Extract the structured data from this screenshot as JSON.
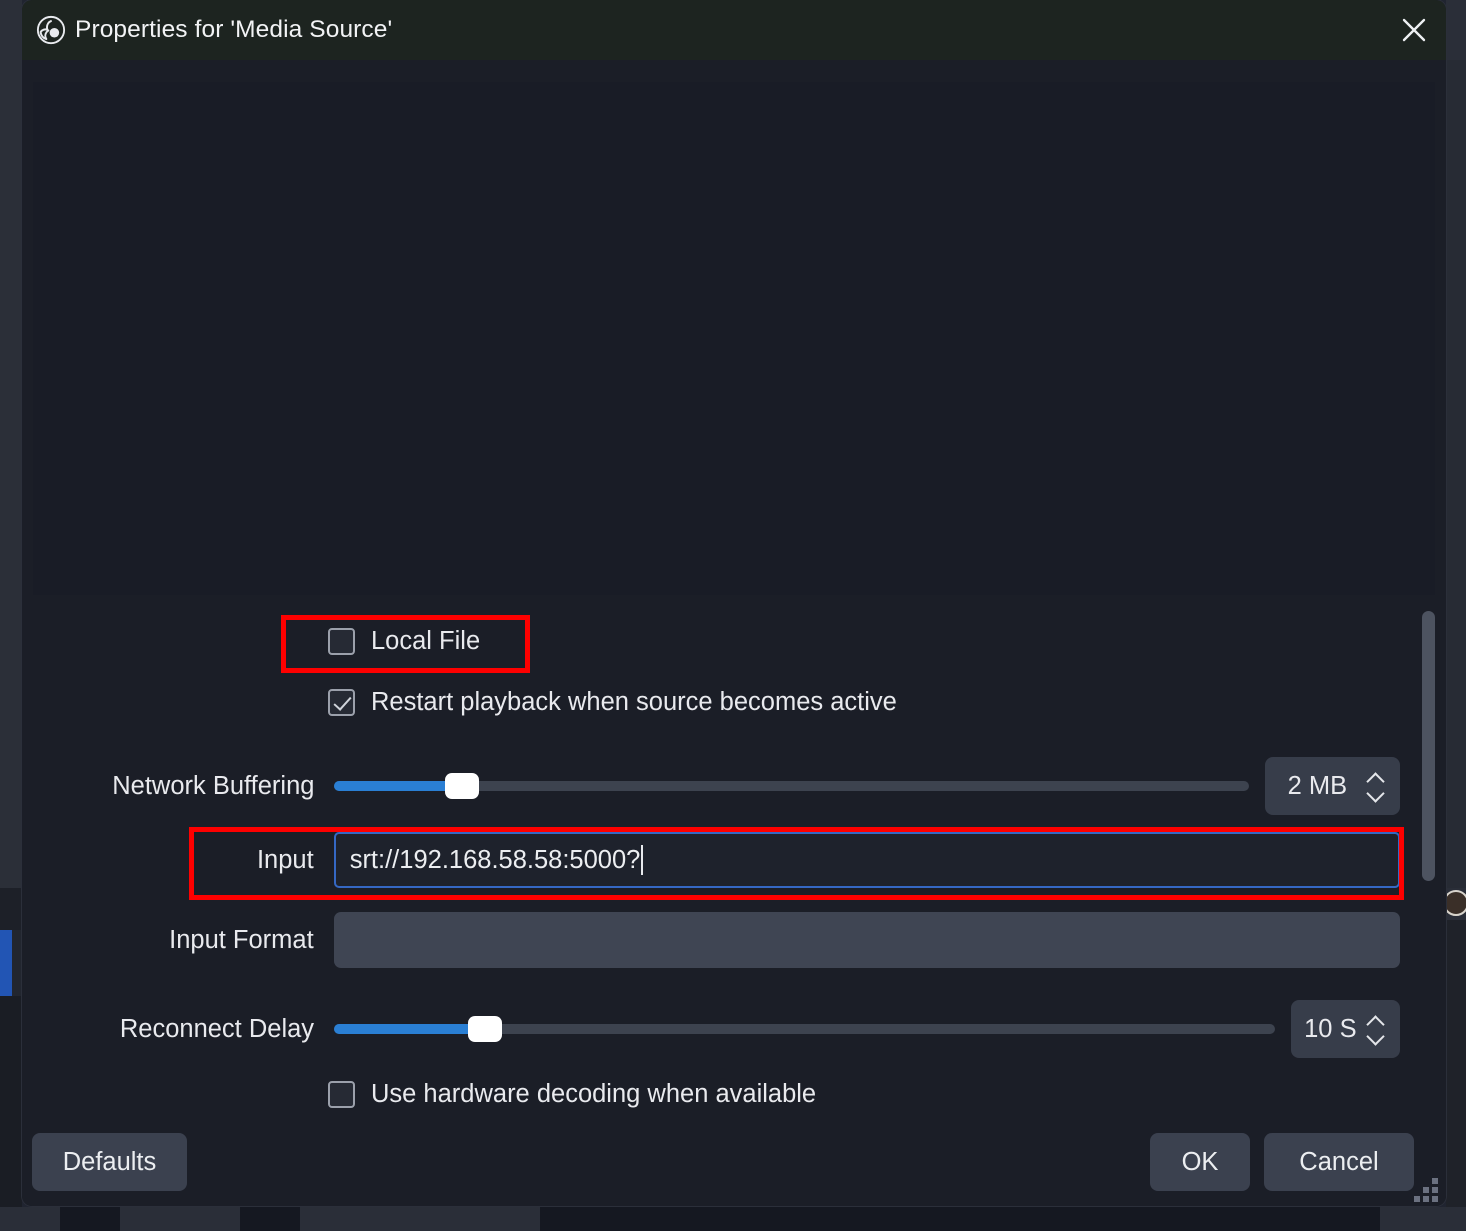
{
  "window": {
    "title": "Properties for 'Media Source'",
    "logo_icon": "obs-logo-icon",
    "close_icon": "close-icon",
    "resize_grip": "resize-grip-icon"
  },
  "preview": {
    "name": "source-preview",
    "content": ""
  },
  "form": {
    "local_file": {
      "label": "Local File",
      "checked": false,
      "highlighted": true
    },
    "restart_playback": {
      "label": "Restart playback when source becomes active",
      "checked": true,
      "highlighted": false
    },
    "network_buffering": {
      "label": "Network Buffering",
      "value_text": "2 MB",
      "slider_percent": 14,
      "up_icon": "chevron-up-icon",
      "down_icon": "chevron-down-icon"
    },
    "input": {
      "label": "Input",
      "value": "srt://192.168.58.58:5000?",
      "placeholder": "",
      "focused": true,
      "highlighted": true
    },
    "input_format": {
      "label": "Input Format",
      "value": "",
      "placeholder": ""
    },
    "reconnect_delay": {
      "label": "Reconnect Delay",
      "value_text": "10 S",
      "slider_percent": 16,
      "up_icon": "chevron-up-icon",
      "down_icon": "chevron-down-icon"
    },
    "hardware_decoding": {
      "label": "Use hardware decoding when available",
      "checked": false
    }
  },
  "footer": {
    "defaults_label": "Defaults",
    "ok_label": "OK",
    "cancel_label": "Cancel"
  },
  "colors": {
    "accent_blue": "#2a7fd4",
    "focus_blue": "#3568c4",
    "annotation_red": "#fe0000",
    "dialog_bg": "#1b1e27",
    "titlebar_bg": "#1d2420",
    "preview_bg": "#191c26"
  }
}
